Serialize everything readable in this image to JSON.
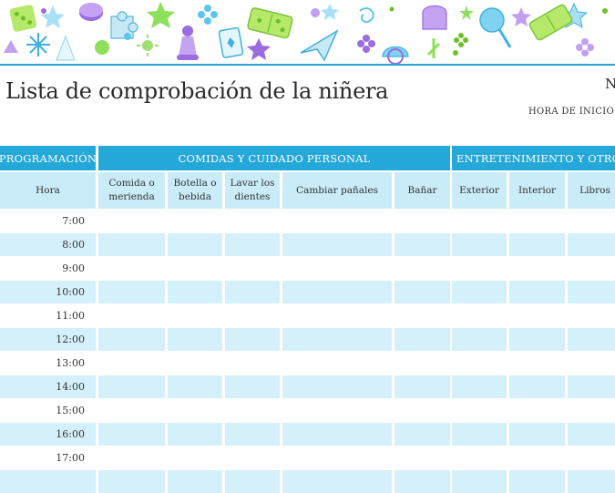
{
  "title": "Lista de comprobación de la niñera",
  "header_right_letter": "N",
  "start_time_label": "HORA DE INICIO DE L",
  "sections": {
    "schedule": "PROGRAMACIÓN",
    "meals": "COMIDAS Y CUIDADO PERSONAL",
    "entertainment": "ENTRETENIMIENTO Y OTROS (A"
  },
  "columns": {
    "hora": "Hora",
    "comida": "Comida o merienda",
    "botella": "Botella o bebida",
    "dientes": "Lavar los dientes",
    "panales": "Cambiar pañales",
    "banar": "Bañar",
    "exterior": "Exterior",
    "interior": "Interior",
    "libros": "Libros"
  },
  "times": [
    "7:00",
    "8:00",
    "9:00",
    "10:00",
    "11:00",
    "12:00",
    "13:00",
    "14:00",
    "15:00",
    "16:00",
    "17:00"
  ],
  "colors": {
    "section_header": "#24a7d9",
    "subheader": "#c9ecf8",
    "row_alt": "#d4f0fa",
    "accent_rule": "#2aa6d8"
  }
}
